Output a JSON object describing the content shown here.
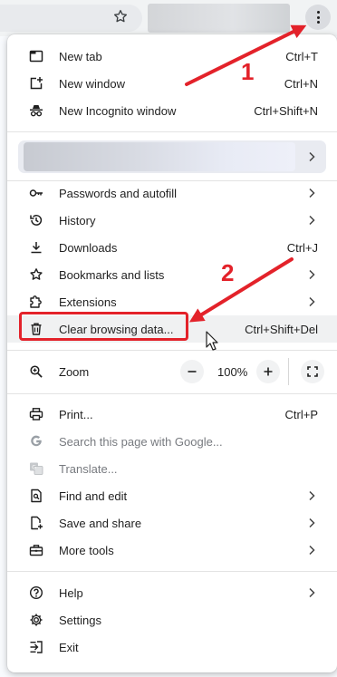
{
  "menu": {
    "group1": [
      {
        "label": "New tab",
        "shortcut": "Ctrl+T",
        "icon": "new-tab-icon"
      },
      {
        "label": "New window",
        "shortcut": "Ctrl+N",
        "icon": "new-window-icon"
      },
      {
        "label": "New Incognito window",
        "shortcut": "Ctrl+Shift+N",
        "icon": "incognito-icon"
      }
    ],
    "group2": [
      {
        "label": "Passwords and autofill",
        "icon": "key-icon",
        "submenu": true
      },
      {
        "label": "History",
        "icon": "history-icon",
        "submenu": true
      },
      {
        "label": "Downloads",
        "shortcut": "Ctrl+J",
        "icon": "download-icon"
      },
      {
        "label": "Bookmarks and lists",
        "icon": "star-icon",
        "submenu": true
      },
      {
        "label": "Extensions",
        "icon": "puzzle-icon",
        "submenu": true
      },
      {
        "label": "Clear browsing data...",
        "shortcut": "Ctrl+Shift+Del",
        "icon": "trash-icon"
      }
    ],
    "zoom": {
      "label": "Zoom",
      "value": "100%",
      "decrease": "−",
      "increase": "+"
    },
    "group3": [
      {
        "label": "Print...",
        "shortcut": "Ctrl+P",
        "icon": "printer-icon"
      },
      {
        "label": "Search this page with Google...",
        "icon": "google-icon",
        "disabled": true
      },
      {
        "label": "Translate...",
        "icon": "translate-icon",
        "disabled": true
      },
      {
        "label": "Find and edit",
        "icon": "find-icon",
        "submenu": true
      },
      {
        "label": "Save and share",
        "icon": "save-share-icon",
        "submenu": true
      },
      {
        "label": "More tools",
        "icon": "toolbox-icon",
        "submenu": true
      }
    ],
    "group4": [
      {
        "label": "Help",
        "icon": "help-icon",
        "submenu": true
      },
      {
        "label": "Settings",
        "icon": "gear-icon"
      },
      {
        "label": "Exit",
        "icon": "exit-icon"
      }
    ]
  },
  "annotations": {
    "step1": "1",
    "step2": "2",
    "color": "#e3222a"
  }
}
